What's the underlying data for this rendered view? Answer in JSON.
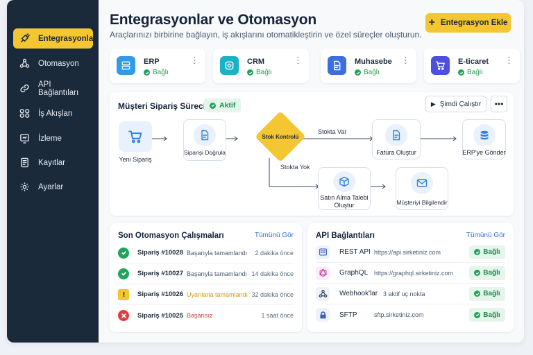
{
  "sidebar": {
    "items": [
      {
        "label": "Entegrasyonlar",
        "icon": "plug-icon",
        "active": true
      },
      {
        "label": "Otomasyon",
        "icon": "nodes-icon"
      },
      {
        "label": "API Bağlantıları",
        "icon": "link-icon"
      },
      {
        "label": "İş Akışları",
        "icon": "flow-icon"
      },
      {
        "label": "İzleme",
        "icon": "monitor-icon"
      },
      {
        "label": "Kayıtlar",
        "icon": "document-icon"
      },
      {
        "label": "Ayarlar",
        "icon": "gear-icon"
      }
    ]
  },
  "header": {
    "title": "Entegrasyonlar ve Otomasyon",
    "subtitle": "Araçlarınızı birbirine bağlayın, iş akışlarını otomatikleştirin ve özel süreçler oluşturun.",
    "add_button": "Entegrasyon Ekle"
  },
  "integrations": [
    {
      "name": "ERP",
      "status": "Bağlı",
      "color": "#2f9bea",
      "icon": "server-icon"
    },
    {
      "name": "CRM",
      "status": "Bağlı",
      "color": "#19b3c7",
      "icon": "crm-icon"
    },
    {
      "name": "Muhasebe",
      "status": "Bağlı",
      "color": "#3b6fe0",
      "icon": "ledger-icon"
    },
    {
      "name": "E-ticaret",
      "status": "Bağlı",
      "color": "#4c4fe0",
      "icon": "cart-icon"
    }
  ],
  "workflow": {
    "title": "Müşteri Sipariş Süreci",
    "status": "Aktif",
    "run_button": "Şimdi Çalıştır",
    "nodes": {
      "new_order": "Yeni Sipariş",
      "validate": "Siparişi Doğrula",
      "stock_check": "Stok Kontrolü",
      "invoice": "Fatura Oluştur",
      "erp_send": "ERP'ye Gönder",
      "purchase": "Satın Alma Talebi Oluştur",
      "notify": "Müşteriyi Bilgilendir"
    },
    "edges": {
      "in_stock": "Stokta Var",
      "out_of_stock": "Stokta Yok"
    }
  },
  "runs": {
    "title": "Son Otomasyon Çalışmaları",
    "see_all": "Tümünü Gör",
    "rows": [
      {
        "id": "Sipariş #10028",
        "status": "Başarıyla tamamlandı",
        "time": "2 dakika önce",
        "kind": "success",
        "color": "#4a5a6e"
      },
      {
        "id": "Sipariş #10027",
        "status": "Başarıyla tamamlandı",
        "time": "14 dakika önce",
        "kind": "success",
        "color": "#4a5a6e"
      },
      {
        "id": "Sipariş #10026",
        "status": "Uyarılarla tamamlandı",
        "time": "32 dakika önce",
        "kind": "warning",
        "color": "#d39a0f"
      },
      {
        "id": "Sipariş #10025",
        "status": "Başarısız",
        "time": "1 saat önce",
        "kind": "error",
        "color": "#d63a3a"
      }
    ]
  },
  "apis": {
    "title": "API Bağlantıları",
    "see_all": "Tümünü Gör",
    "rows": [
      {
        "name": "REST API",
        "url": "https://api.sirketiniz.com",
        "status": "Bağlı",
        "icon": "rest-icon"
      },
      {
        "name": "GraphQL",
        "url": "https://graphql.sirketiniz.com",
        "status": "Bağlı",
        "icon": "graphql-icon"
      },
      {
        "name": "Webhook'lar",
        "url": "3 aktif uç nokta",
        "status": "Bağlı",
        "icon": "webhook-icon"
      },
      {
        "name": "SFTP",
        "url": "sftp.sirketiniz.com",
        "status": "Bağlı",
        "icon": "sftp-icon"
      }
    ]
  }
}
